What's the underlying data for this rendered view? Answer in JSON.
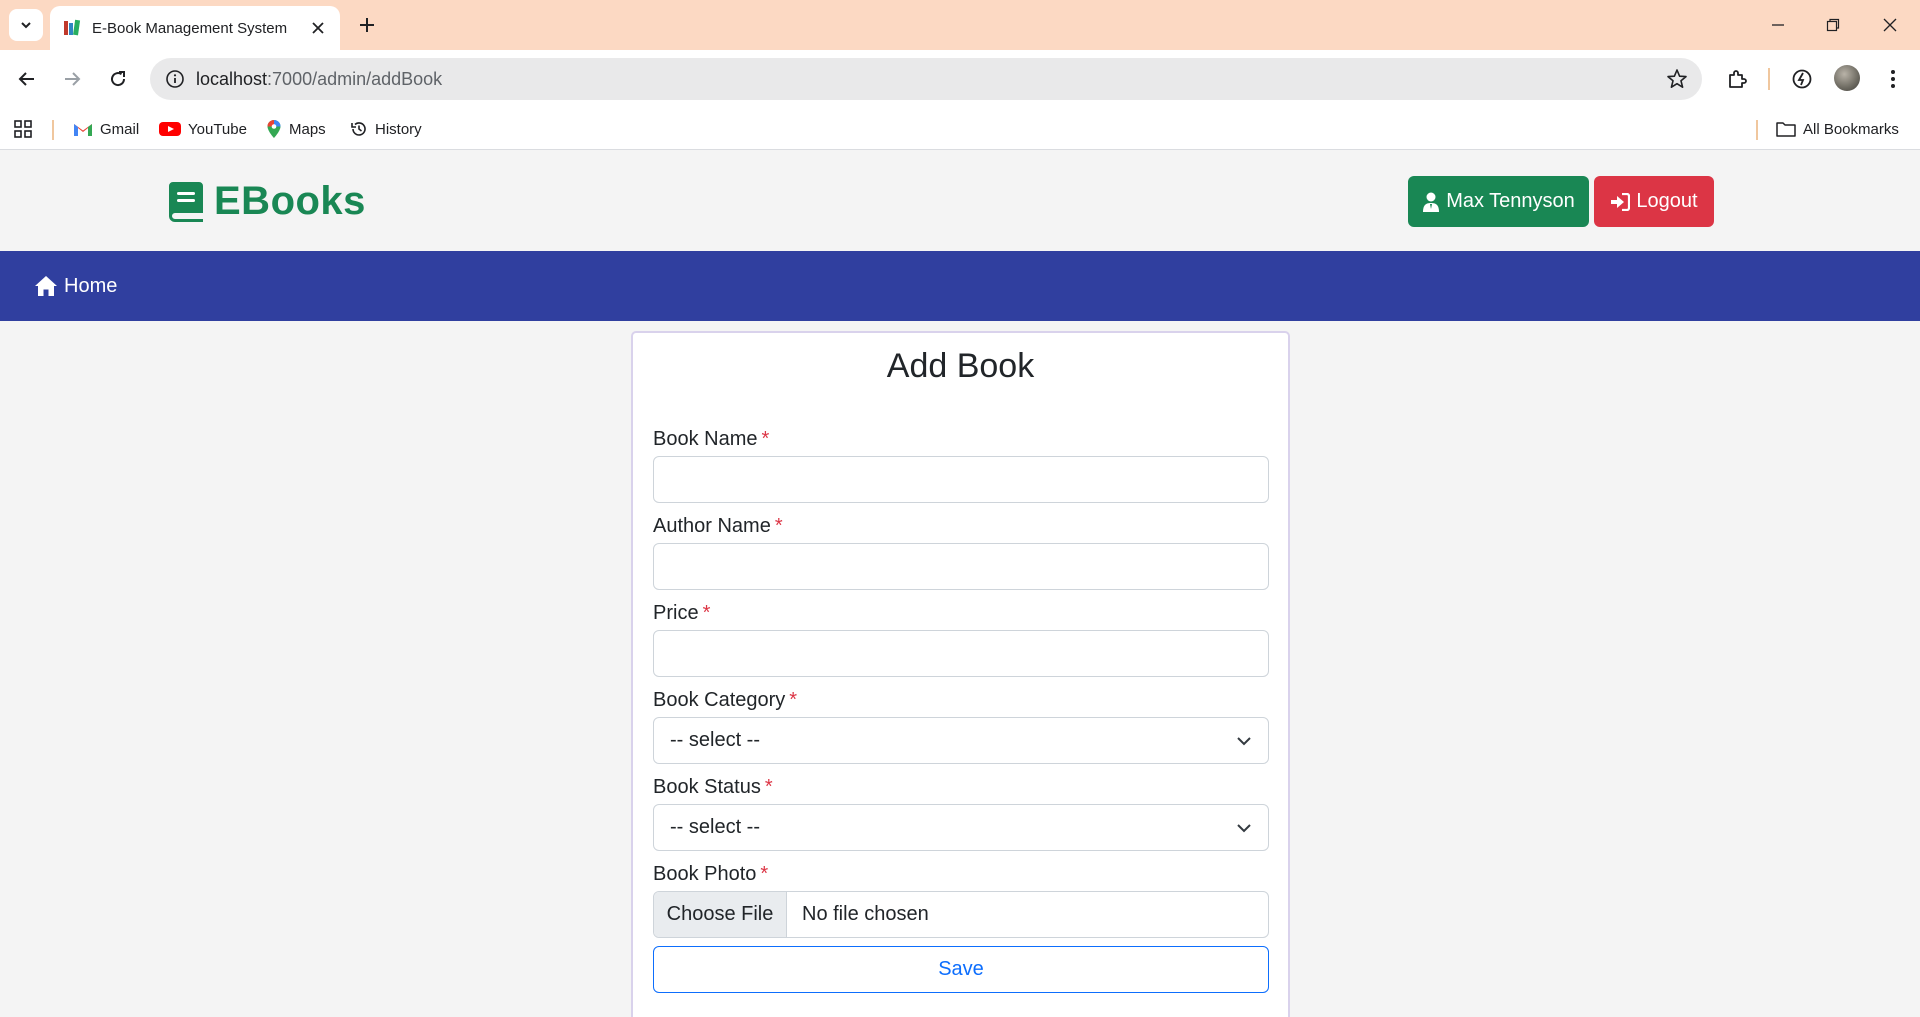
{
  "browser": {
    "tab_title": "E-Book Management System",
    "url_host": "localhost",
    "url_path": ":7000/admin/addBook",
    "bookmarks": [
      {
        "label": "Gmail",
        "icon": "gmail-icon"
      },
      {
        "label": "YouTube",
        "icon": "youtube-icon"
      },
      {
        "label": "Maps",
        "icon": "maps-icon"
      },
      {
        "label": "History",
        "icon": "history-icon"
      }
    ],
    "all_bookmarks": "All Bookmarks"
  },
  "header": {
    "brand": "EBooks",
    "user_name": "Max Tennyson",
    "logout_label": "Logout"
  },
  "nav": {
    "home_label": "Home"
  },
  "form": {
    "title": "Add Book",
    "required_mark": "*",
    "book_name_label": "Book Name",
    "book_name_value": "",
    "author_name_label": "Author Name",
    "author_name_value": "",
    "price_label": "Price",
    "price_value": "",
    "category_label": "Book Category",
    "category_selected": "-- select --",
    "status_label": "Book Status",
    "status_selected": "-- select --",
    "photo_label": "Book Photo",
    "choose_file_label": "Choose File",
    "no_file_text": "No file chosen",
    "save_label": "Save"
  },
  "colors": {
    "brand_green": "#198754",
    "logout_red": "#dc3545",
    "navbar_blue": "#303f9f",
    "save_blue": "#0d6efd",
    "tabstrip": "#fcd9c3"
  }
}
